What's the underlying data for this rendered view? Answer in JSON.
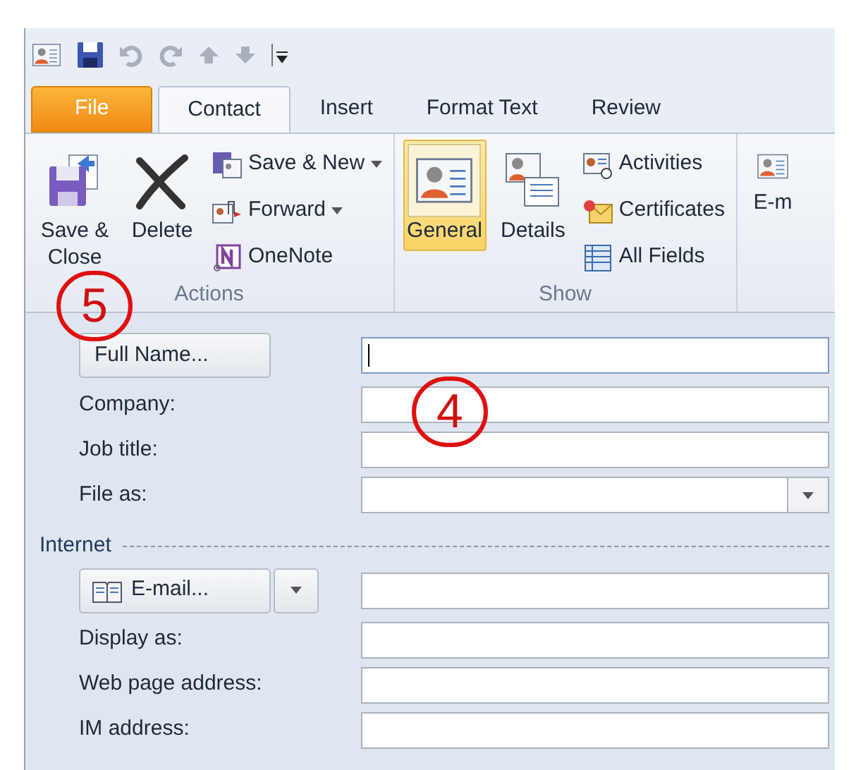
{
  "tabs": [
    {
      "label": "File",
      "kind": "file",
      "selected": false
    },
    {
      "label": "Contact",
      "kind": "tab",
      "selected": true
    },
    {
      "label": "Insert",
      "kind": "tab",
      "selected": false
    },
    {
      "label": "Format Text",
      "kind": "tab",
      "selected": false
    },
    {
      "label": "Review",
      "kind": "tab",
      "selected": false
    }
  ],
  "ribbon_groups": [
    {
      "label": "Actions",
      "items": [
        {
          "label": "Save & Close",
          "kind": "large",
          "selected": false
        },
        {
          "label": "Delete",
          "kind": "large",
          "selected": false
        },
        {
          "label": "Save & New",
          "kind": "small",
          "selected": false,
          "dropdown": true
        },
        {
          "label": "Forward",
          "kind": "small",
          "selected": false,
          "dropdown": true
        },
        {
          "label": "OneNote",
          "kind": "small",
          "selected": false,
          "dropdown": false
        }
      ]
    },
    {
      "label": "Show",
      "items": [
        {
          "label": "General",
          "kind": "large",
          "selected": true
        },
        {
          "label": "Details",
          "kind": "large",
          "selected": false
        },
        {
          "label": "Activities",
          "kind": "small",
          "selected": false,
          "dropdown": false
        },
        {
          "label": "Certificates",
          "kind": "small",
          "selected": false,
          "dropdown": false
        },
        {
          "label": "All Fields",
          "kind": "small",
          "selected": false,
          "dropdown": false
        }
      ]
    },
    {
      "items": [
        {
          "label": "E-m",
          "kind": "large",
          "selected": false
        }
      ]
    }
  ],
  "form_rows": [
    {
      "kind": "button",
      "label": "Full Name...",
      "focused": true
    },
    {
      "kind": "text",
      "label": "Company:",
      "focused": false
    },
    {
      "kind": "text",
      "label": "Job title:",
      "focused": false
    },
    {
      "kind": "combo",
      "label": "File as:",
      "focused": false
    },
    {
      "kind": "section",
      "label": "Internet"
    },
    {
      "kind": "split",
      "label": "E-mail...",
      "focused": false
    },
    {
      "kind": "text",
      "label": "Display as:",
      "focused": false
    },
    {
      "kind": "text",
      "label": "Web page address:",
      "focused": false
    },
    {
      "kind": "text",
      "label": "IM address:",
      "focused": false
    }
  ],
  "annotations": [
    {
      "text": "5"
    },
    {
      "text": "4"
    }
  ]
}
